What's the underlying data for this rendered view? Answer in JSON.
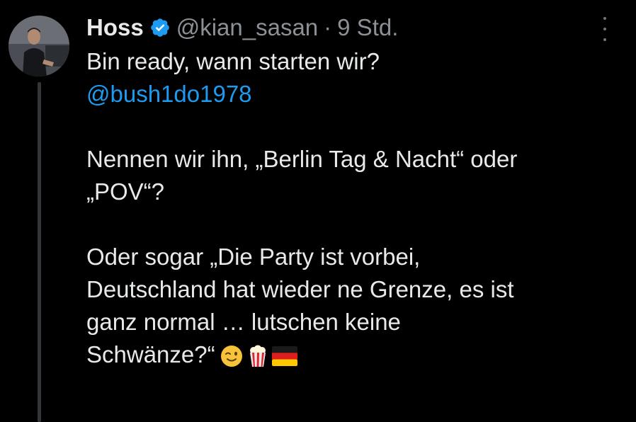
{
  "tweet": {
    "author": {
      "display_name": "Hoss",
      "handle": "@kian_sasan",
      "separator": "·",
      "time": "9 Std.",
      "verified_icon": "verified-badge-icon"
    },
    "more_icon": "more-options-icon",
    "lines": [
      "Bin ready, wann starten wir?",
      "@bush1do1978",
      "",
      "Nennen wir ihn, „Berlin Tag & Nacht“ oder",
      "„POV“?",
      "",
      "Oder sogar „Die Party ist vorbei,",
      "Deutschland hat wieder ne Grenze, es ist",
      "ganz normal … lutschen keine",
      "Schwänze?“"
    ],
    "mention": "@bush1do1978",
    "trailing_emojis": [
      "winking-face-emoji",
      "popcorn-emoji",
      "germany-flag-emoji"
    ]
  },
  "colors": {
    "background": "#000000",
    "text": "#e7e9ea",
    "secondary": "#8b9196",
    "link": "#1d9bf0",
    "verified": "#1d9bf0",
    "thread_line": "#333639"
  }
}
